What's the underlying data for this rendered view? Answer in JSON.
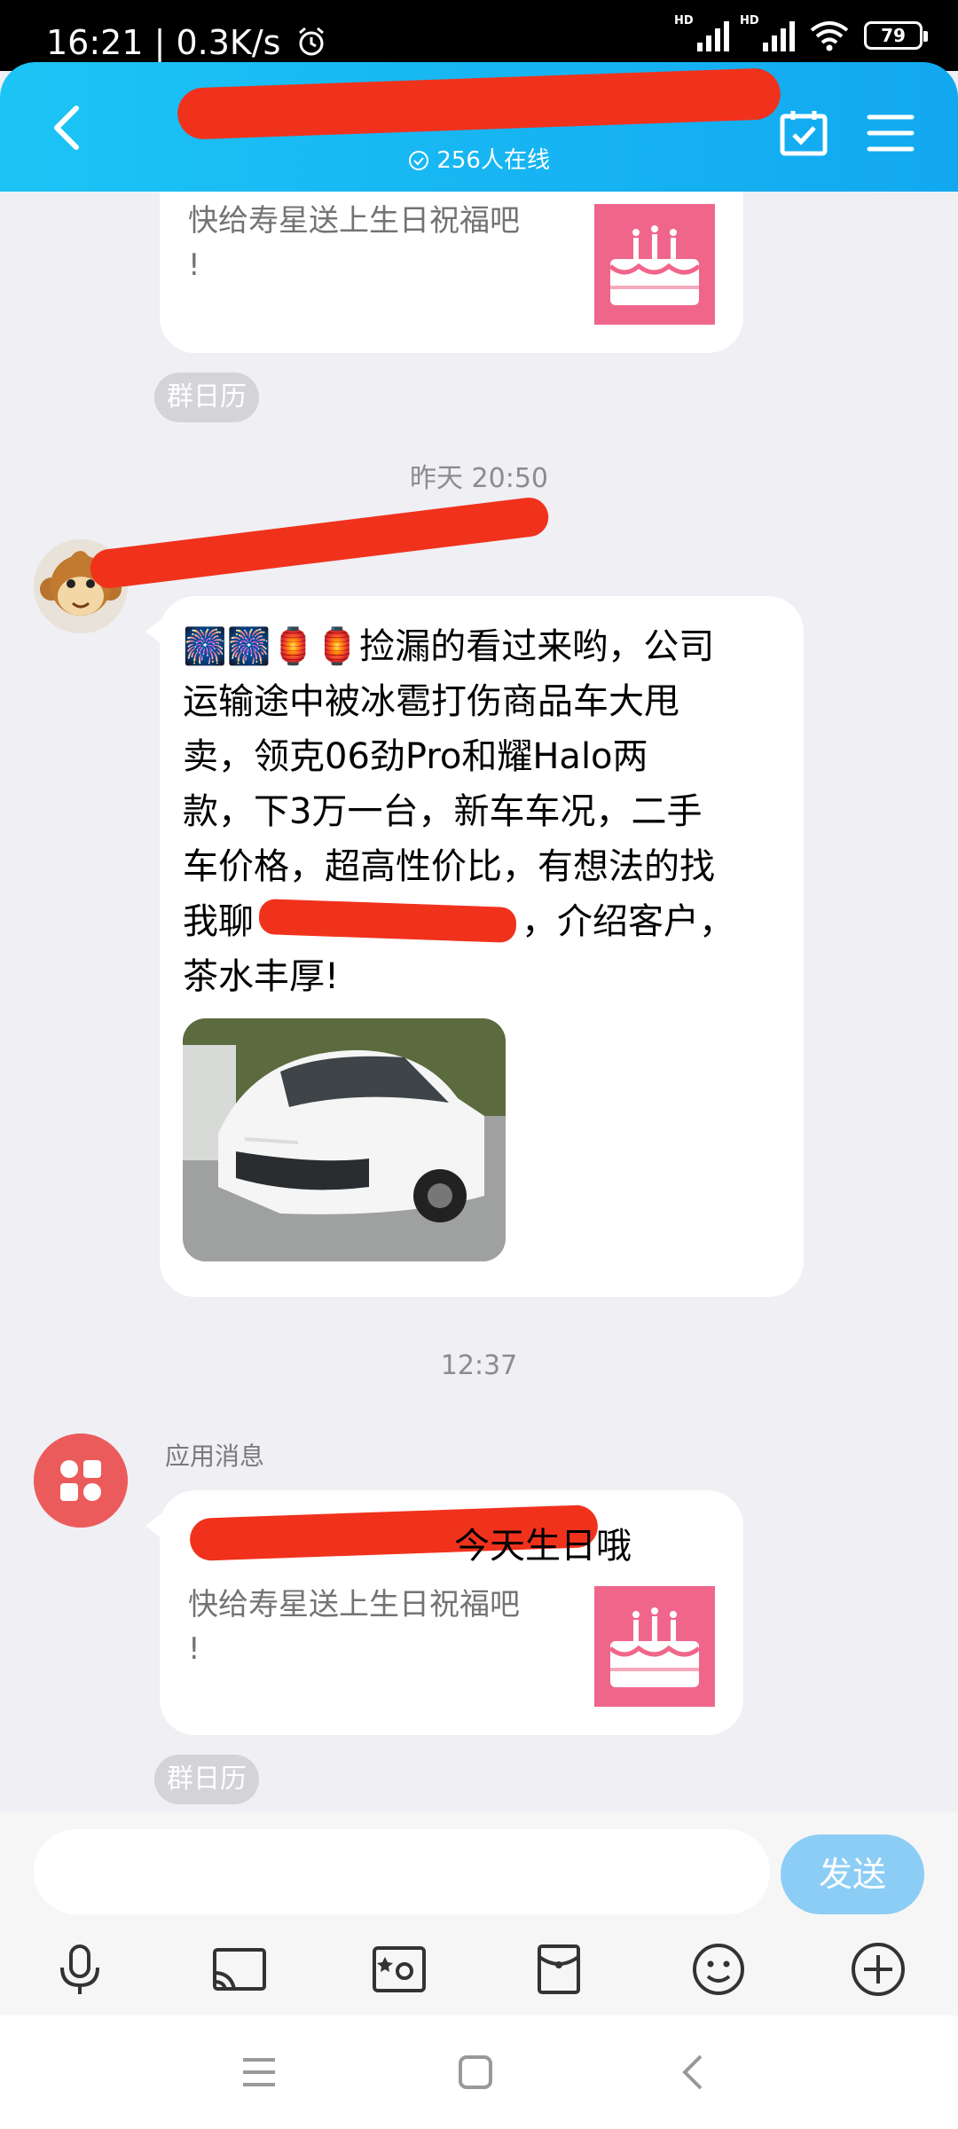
{
  "status_bar": {
    "time_speed": "16:21 | 0.3K/s",
    "battery": "79"
  },
  "header": {
    "online_count": "256人在线",
    "online_icon": "check-circle-icon"
  },
  "messages": {
    "card1_desc_line1": "快给寿星送上生日祝福吧",
    "card1_desc_line2": "!",
    "calendar_chip1": "群日历",
    "time1": "昨天 20:50",
    "post_lines": [
      "🎆🎆🏮🏮捡漏的看过来哟，公司",
      "运输途中被冰雹打伤商品车大甩",
      "卖，领克06劲Pro和耀Halo两",
      "款，下3万一台，新车车况，二手",
      "车价格，超高性价比，有想法的找",
      "我聊",
      "茶水丰厚!"
    ],
    "post_line6_tail": "，介绍客户，",
    "time2": "12:37",
    "app_sender": "应用消息",
    "card2_title_tail": "今天生日哦",
    "card2_desc_line1": "快给寿星送上生日祝福吧",
    "card2_desc_line2": "!",
    "calendar_chip2": "群日历"
  },
  "input": {
    "placeholder": "",
    "send_label": "发送"
  },
  "toolbar_icons": [
    "microphone-icon",
    "cast-icon",
    "photo-icon",
    "red-packet-icon",
    "emoji-icon",
    "plus-icon"
  ],
  "colors": {
    "header_blue": "#12a8f0",
    "redaction": "#f0321d",
    "send_button": "#8ccdf5",
    "cake_pink": "#f0668b"
  }
}
